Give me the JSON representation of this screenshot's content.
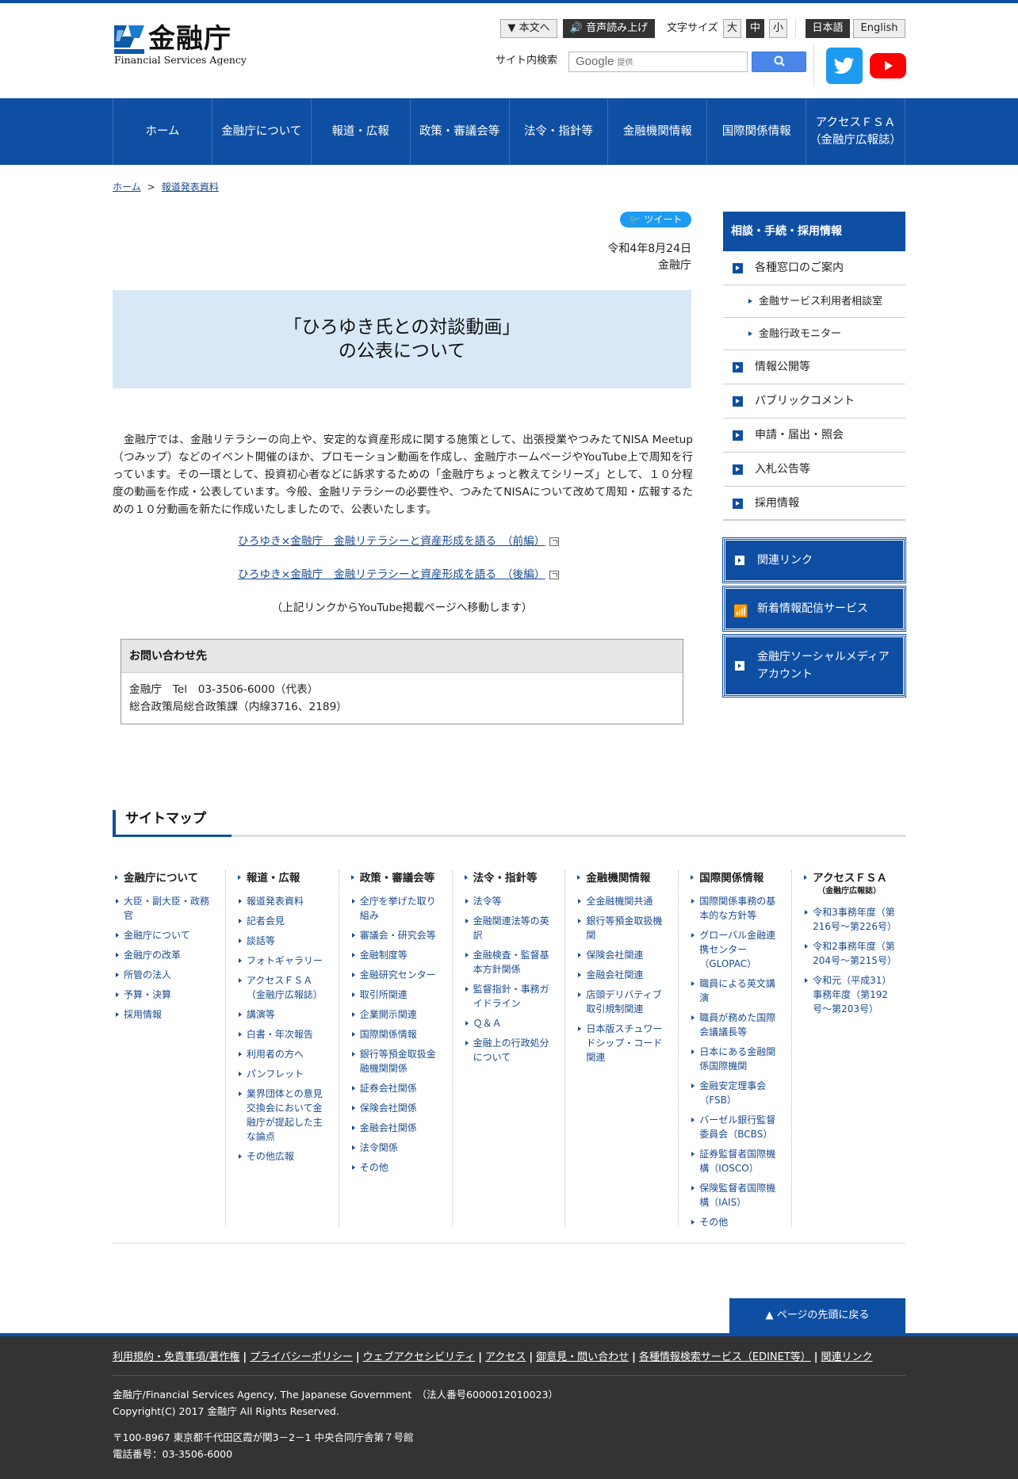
{
  "header": {
    "logo_jp": "金融庁",
    "logo_en": "Financial Services Agency",
    "skip_label": "本文へ",
    "voice_label": "音声読み上げ",
    "font_size_label": "文字サイズ",
    "font_sizes": [
      "大",
      "中",
      "小"
    ],
    "lang_ja": "日本語",
    "lang_en": "English",
    "search_label": "サイト内検索",
    "search_brand": "Google",
    "search_by": "提供"
  },
  "nav": [
    "ホーム",
    "金融庁について",
    "報道・広報",
    "政策・審議会等",
    "法令・指針等",
    "金融機関情報",
    "国際関係情報",
    "アクセスＦＳＡ",
    "（金融庁広報誌）"
  ],
  "breadcrumb": {
    "home": "ホーム",
    "sep": ">",
    "current": "報道発表資料"
  },
  "article": {
    "tweet": "ツイート",
    "date": "令和4年8月24日",
    "agency": "金融庁",
    "title_line1": "「ひろゆき氏との対談動画」",
    "title_line2": "の公表について",
    "body": "　金融庁では、金融リテラシーの向上や、安定的な資産形成に関する施策として、出張授業やつみたてNISA Meetup（つみップ）などのイベント開催のほか、プロモーション動画を作成し、金融庁ホームページやYouTube上で周知を行っています。その一環として、投資初心者などに訴求するための「金融庁ちょっと教えてシリーズ」として、１０分程度の動画を作成・公表しています。今般、金融リテラシーの必要性や、つみたてNISAについて改めて周知・広報するための１０分動画を新たに作成いたしましたので、公表いたします。",
    "link1": "ひろゆき×金融庁　金融リテラシーと資産形成を語る　（前編）",
    "link2": "ひろゆき×金融庁　金融リテラシーと資産形成を語る　（後編）",
    "note": "（上記リンクからYouTube掲載ページへ移動します）",
    "contact_title": "お問い合わせ先",
    "contact_line1": "金融庁　Tel　03-3506-6000（代表）",
    "contact_line2": "総合政策局総合政策課（内線3716、2189）"
  },
  "sidebar": {
    "title": "相談・手続・採用情報",
    "items": [
      "各種窓口のご案内",
      "情報公開等",
      "パブリックコメント",
      "申請・届出・照会",
      "入札公告等",
      "採用情報"
    ],
    "sub_items": [
      "金融サービス利用者相談室",
      "金融行政モニター"
    ],
    "buttons": [
      "関連リンク",
      "新着情報配信サービス",
      "金融庁ソーシャルメディア",
      "アカウント"
    ]
  },
  "sitemap": {
    "title": "サイトマップ",
    "columns": [
      {
        "heading": "金融庁について",
        "items": [
          "大臣・副大臣・政務官",
          "金融庁について",
          "金融庁の改革",
          "所管の法人",
          "予算・決算",
          "採用情報"
        ]
      },
      {
        "heading": "報道・広報",
        "items": [
          "報道発表資料",
          "記者会見",
          "談話等",
          "フォトギャラリー",
          "アクセスＦＳＡ（金融庁広報誌）",
          "講演等",
          "白書・年次報告",
          "利用者の方へ",
          "パンフレット",
          "業界団体との意見交換会において金融庁が提起した主な論点",
          "その他広報"
        ]
      },
      {
        "heading": "政策・審議会等",
        "items": [
          "全庁を挙げた取り組み",
          "審議会・研究会等",
          "金融制度等",
          "金融研究センター",
          "取引所関連",
          "企業開示関連",
          "国際関係情報",
          "銀行等預金取扱金融機関関係",
          "証券会社関係",
          "保険会社関係",
          "金融会社関係",
          "法令関係",
          "その他"
        ]
      },
      {
        "heading": "法令・指針等",
        "items": [
          "法令等",
          "金融関連法等の英訳",
          "金融検査・監督基本方針関係",
          "監督指針・事務ガイドライン",
          "Ｑ＆Ａ",
          "金融上の行政処分について"
        ]
      },
      {
        "heading": "金融機関情報",
        "items": [
          "全金融機関共通",
          "銀行等預金取扱機関",
          "保険会社関連",
          "金融会社関連",
          "店頭デリバティブ取引規制関連",
          "日本版スチュワードシップ・コード関連"
        ]
      },
      {
        "heading": "国際関係情報",
        "items": [
          "国際関係事務の基本的な方針等",
          "グローバル金融連携センター（GLOPAC）",
          "職員による英文講演",
          "職員が務めた国際会議議長等",
          "日本にある金融関係国際機関",
          "金融安定理事会（FSB）",
          "バーゼル銀行監督委員会（BCBS）",
          "証券監督者国際機構（IOSCO）",
          "保険監督者国際機構（IAIS）",
          "その他"
        ]
      },
      {
        "heading": "アクセスＦＳＡ",
        "subheading": "（金融庁広報誌）",
        "items": [
          "令和3事務年度（第216号～第226号）",
          "令和2事務年度（第204号～第215号）",
          "令和元（平成31）事務年度（第192号～第203号）"
        ]
      }
    ]
  },
  "to_top": "ページの先頭に戻る",
  "footer": {
    "links": [
      "利用規約・免責事項/著作権",
      "プライバシーポリシー",
      "ウェブアクセシビリティ",
      "アクセス",
      "御意見・問い合わせ",
      "各種情報検索サービス（EDINET等）",
      "関連リンク"
    ],
    "org": "金融庁/Financial Services Agency, The Japanese Government　（法人番号6000012010023）",
    "copyright": "Copyright(C) 2017 金融庁 All Rights Reserved.",
    "address": "〒100-8967 東京都千代田区霞が関3－2－1 中央合同庁舎第７号館",
    "phone": "電話番号：03-3506-6000"
  },
  "colors": {
    "brand_blue": "#0e4fa3",
    "title_bg": "#d9e8f7",
    "footer_bg": "#333333"
  }
}
